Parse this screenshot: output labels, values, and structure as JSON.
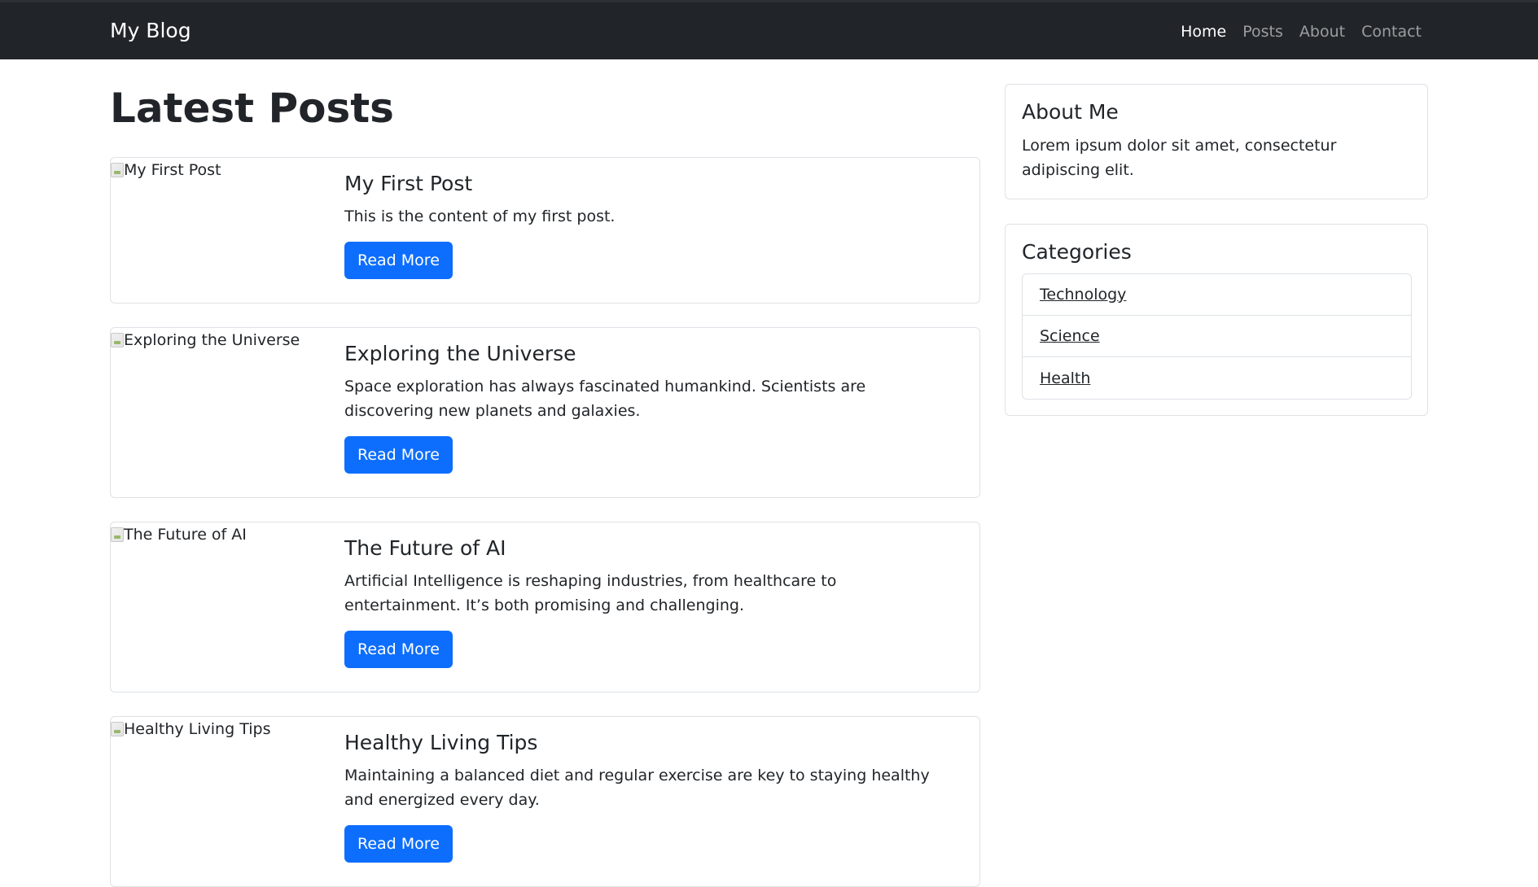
{
  "navbar": {
    "brand": "My Blog",
    "links": [
      {
        "label": "Home",
        "active": true
      },
      {
        "label": "Posts",
        "active": false
      },
      {
        "label": "About",
        "active": false
      },
      {
        "label": "Contact",
        "active": false
      }
    ]
  },
  "main": {
    "title": "Latest Posts",
    "posts": [
      {
        "image_alt": "My First Post",
        "title": "My First Post",
        "text": "This is the content of my first post.",
        "button": "Read More"
      },
      {
        "image_alt": "Exploring the Universe",
        "title": "Exploring the Universe",
        "text": "Space exploration has always fascinated humankind. Scientists are discovering new planets and galaxies.",
        "button": "Read More"
      },
      {
        "image_alt": "The Future of AI",
        "title": "The Future of AI",
        "text": "Artificial Intelligence is reshaping industries, from healthcare to entertainment. It’s both promising and challenging.",
        "button": "Read More"
      },
      {
        "image_alt": "Healthy Living Tips",
        "title": "Healthy Living Tips",
        "text": "Maintaining a balanced diet and regular exercise are key to staying healthy and energized every day.",
        "button": "Read More"
      }
    ]
  },
  "sidebar": {
    "about": {
      "title": "About Me",
      "text": "Lorem ipsum dolor sit amet, consectetur adipiscing elit."
    },
    "categories": {
      "title": "Categories",
      "items": [
        "Technology",
        "Science",
        "Health"
      ]
    }
  },
  "colors": {
    "navbar_bg": "#212529",
    "primary": "#0d6efd",
    "border": "#dee2e6"
  }
}
